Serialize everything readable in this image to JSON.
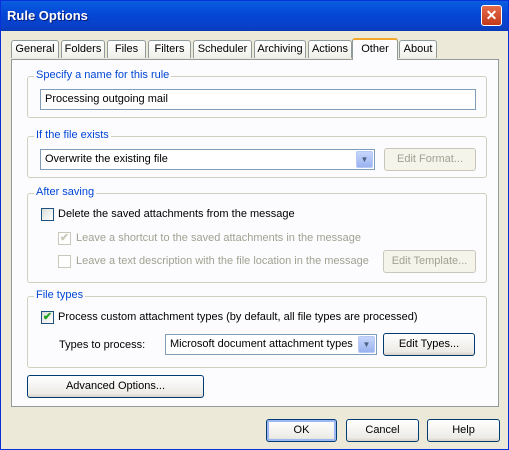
{
  "window": {
    "title": "Rule Options",
    "close_glyph": "✕"
  },
  "tabs": [
    {
      "label": "General"
    },
    {
      "label": "Folders"
    },
    {
      "label": "Files"
    },
    {
      "label": "Filters"
    },
    {
      "label": "Scheduler"
    },
    {
      "label": "Archiving"
    },
    {
      "label": "Actions"
    },
    {
      "label": "Other",
      "active": true
    },
    {
      "label": "About"
    }
  ],
  "name_group": {
    "legend": "Specify a name for this rule",
    "value": "Processing outgoing mail"
  },
  "file_exists": {
    "legend": "If the file exists",
    "selected": "Overwrite the existing file",
    "edit_format": "Edit Format..."
  },
  "after_saving": {
    "legend": "After saving",
    "delete_label": "Delete the saved attachments from the message",
    "delete_checked": false,
    "shortcut_label": "Leave a shortcut to the saved attachments in the  message",
    "shortcut_checked": true,
    "text_label": "Leave a text description with the file location in the message",
    "text_checked": false,
    "edit_template": "Edit Template..."
  },
  "file_types": {
    "legend": "File types",
    "process_label": "Process custom attachment types (by default, all file types are processed)",
    "process_checked": true,
    "types_label": "Types to process:",
    "types_selected": "Microsoft document attachment types",
    "edit_types": "Edit Types..."
  },
  "advanced_button": "Advanced Options...",
  "footer": {
    "ok": "OK",
    "cancel": "Cancel",
    "help": "Help"
  },
  "check_glyph": "✔",
  "arrow_glyph": "▼"
}
